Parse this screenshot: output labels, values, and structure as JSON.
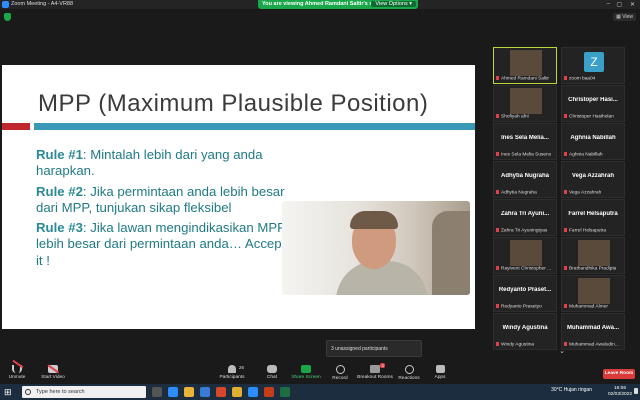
{
  "window": {
    "title": "Zoom Meeting - A4-VR88",
    "banner_text": "You are viewing Ahmed Ramdani Saltir's screen",
    "view_options": "View Options ▾",
    "view_label": "▦ View",
    "controls": [
      "–",
      "▢",
      "✕"
    ]
  },
  "slide": {
    "title": "MPP (Maximum Plausible Position)",
    "rules": [
      {
        "label": "Rule #1",
        "text": ": Mintalah lebih dari yang anda harapkan."
      },
      {
        "label": "Rule #2",
        "text": ": Jika permintaan anda lebih besar dari MPP, tunjukan sikap fleksibel"
      },
      {
        "label": "Rule #3",
        "text": ": Jika lawan mengindikasikan MPP lebih besar dari permintaan anda… Accept it !"
      }
    ],
    "colors": {
      "red": "#c0272d",
      "teal": "#3a99b6",
      "text": "#1f7a85"
    }
  },
  "gallery": {
    "participants": [
      {
        "big": "",
        "small": "Ahmed Ramdani Saltir",
        "type": "video",
        "active": true
      },
      {
        "big": "Z",
        "small": "zoom baa04",
        "type": "avatar"
      },
      {
        "big": "",
        "small": "Shofiyah afni",
        "type": "video"
      },
      {
        "big": "Christoper Hasi...",
        "small": "Christoper Hasiholan",
        "type": "name"
      },
      {
        "big": "Ines Sela Melia...",
        "small": "Ines Sela Melia Suseno",
        "type": "name"
      },
      {
        "big": "Aghnia Nabillah",
        "small": "Aghnia Nabillah",
        "type": "name"
      },
      {
        "big": "Adhytia Nugraha",
        "small": "Adhytia Nugraha",
        "type": "name"
      },
      {
        "big": "Vega Azzahrah",
        "small": "Vega Azzahrah",
        "type": "name"
      },
      {
        "big": "Zahra Tri Ayuni...",
        "small": "Zahra Tri Ayuningtyas",
        "type": "name"
      },
      {
        "big": "Farrel Helsaputra",
        "small": "Farrel Helsaputra",
        "type": "name"
      },
      {
        "big": "",
        "small": "Rayivent Christopher ...",
        "type": "video"
      },
      {
        "big": "",
        "small": "Brathandhika Pradipta",
        "type": "video"
      },
      {
        "big": "Redyanto Praset...",
        "small": "Redyanto Prasetyo",
        "type": "name"
      },
      {
        "big": "",
        "small": "Muhammad Almer",
        "type": "video"
      },
      {
        "big": "Windy Agustina",
        "small": "Windy Agustina",
        "type": "name"
      },
      {
        "big": "Muhammad Awa...",
        "small": "Muhammad Awaludin...",
        "type": "name"
      }
    ],
    "more": "⌄"
  },
  "unassigned": "3 unassigned participants",
  "toolbar": {
    "unmute": "Unmute",
    "start_video": "Start Video",
    "participants": "Participants",
    "participants_count": "26",
    "chat": "Chat",
    "share_screen": "Share Screen",
    "record": "Record",
    "breakout_rooms": "Breakout Rooms",
    "breakout_badge": "3",
    "reactions": "Reactions",
    "apps": "Apps",
    "leave": "Leave Room"
  },
  "taskbar": {
    "search_placeholder": "Type here to search",
    "weather": "30°C  Hujan ringan",
    "time": "16:06",
    "date": "02/03/2022"
  }
}
